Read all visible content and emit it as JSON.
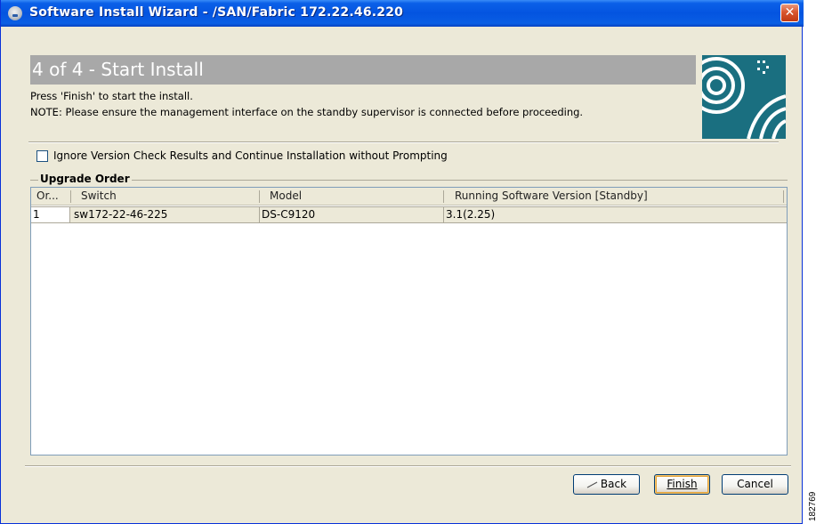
{
  "window": {
    "title": "Software Install Wizard - /SAN/Fabric 172.22.46.220",
    "close_glyph": "✕"
  },
  "step": {
    "title": "4 of 4 - Start Install",
    "line1": "Press 'Finish' to start the install.",
    "line2": "NOTE: Please ensure the management interface on the standby supervisor is connected before proceeding."
  },
  "options": {
    "ignore_check_label": "Ignore Version Check Results and Continue Installation without Prompting",
    "ignore_checked": false
  },
  "upgrade": {
    "legend": "Upgrade Order",
    "columns": [
      "Or...",
      "Switch",
      "Model",
      "Running Software Version [Standby]"
    ],
    "rows": [
      {
        "order": "1",
        "switch": "sw172-22-46-225",
        "model": "DS-C9120",
        "version": "3.1(2.25)"
      }
    ]
  },
  "buttons": {
    "back": "Back",
    "finish": "Finish",
    "cancel": "Cancel"
  },
  "side_code": "182769",
  "colors": {
    "titlebar": "#0454e0",
    "banner": "#a8a8a8",
    "dialog_bg": "#ece9d8",
    "logo_teal": "#1a6f80"
  }
}
